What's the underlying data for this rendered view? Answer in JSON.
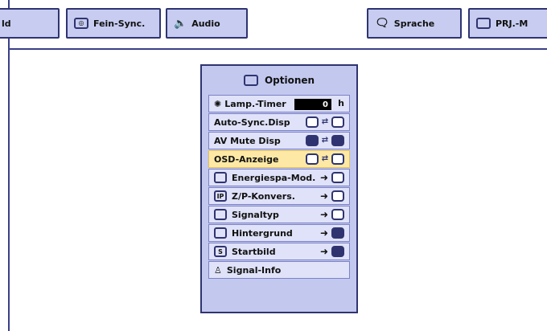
{
  "tabs": [
    {
      "label": "ld"
    },
    {
      "label": "Fein-Sync."
    },
    {
      "label": "Audio"
    },
    {
      "label": "Sprache"
    },
    {
      "label": "PRJ.-M"
    }
  ],
  "menu": {
    "title": "Optionen",
    "items": [
      {
        "label": "Lamp.-Timer",
        "value": "0",
        "unit": "h"
      },
      {
        "label": "Auto-Sync.Disp"
      },
      {
        "label": "AV Mute Disp"
      },
      {
        "label": "OSD-Anzeige"
      },
      {
        "label": "Energiespa-Mod."
      },
      {
        "label": "Z/P-Konvers."
      },
      {
        "label": "Signaltyp"
      },
      {
        "label": "Hintergrund"
      },
      {
        "label": "Startbild"
      },
      {
        "label": "Signal-Info"
      }
    ]
  },
  "colors": {
    "accent": "#2f3470",
    "panel": "#c3c8ef",
    "selected": "#fde9a5"
  }
}
